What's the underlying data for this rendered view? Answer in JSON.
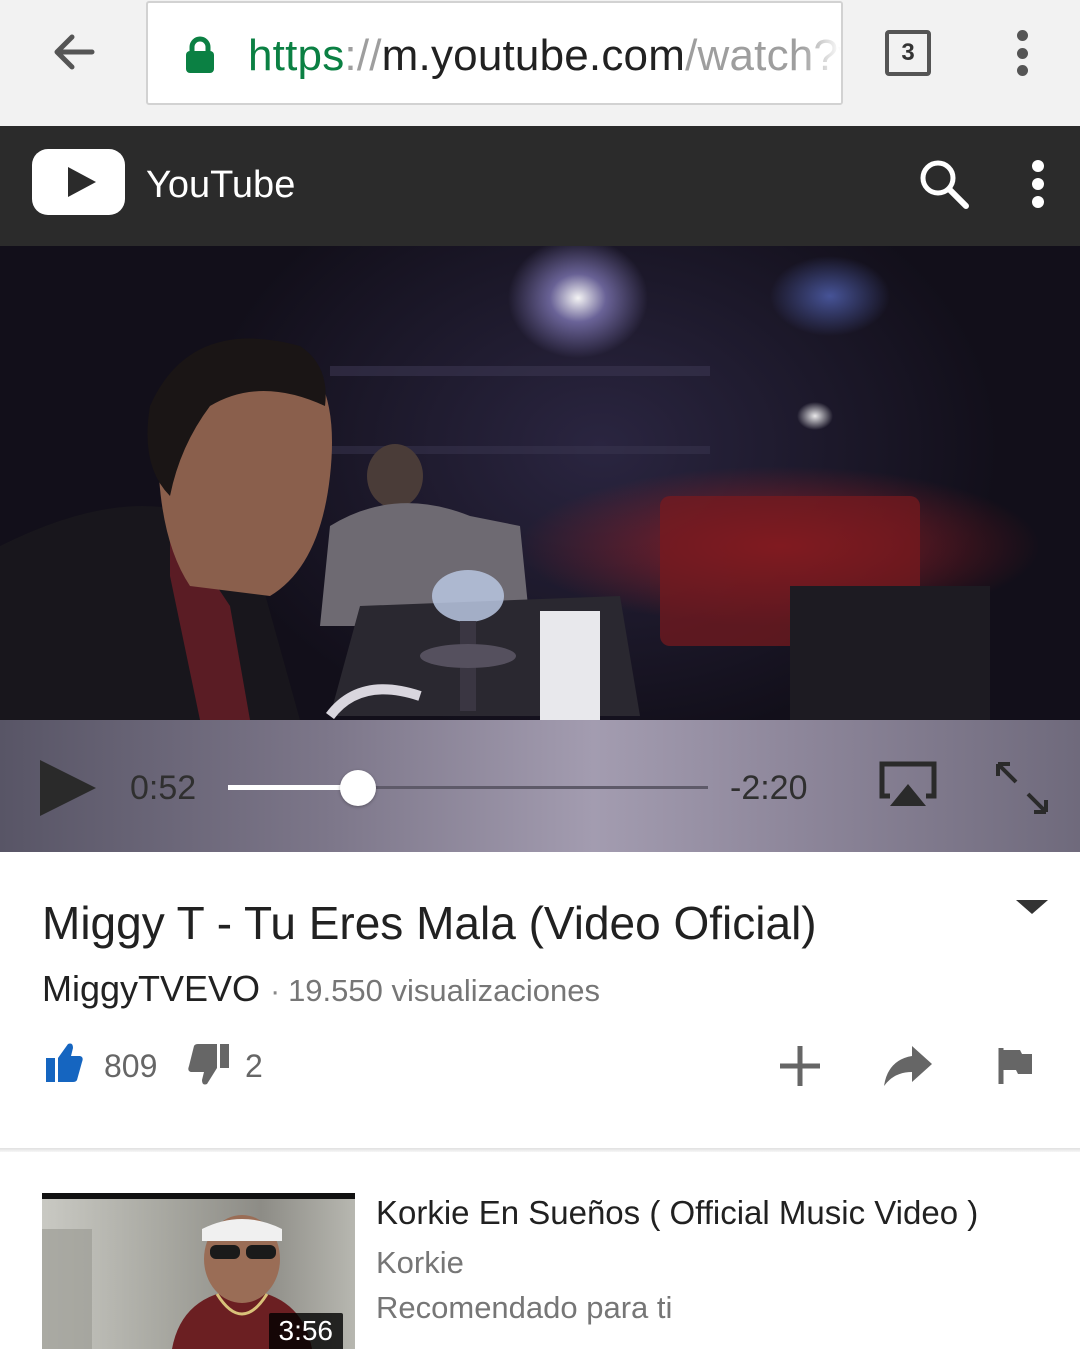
{
  "browser": {
    "url_scheme": "https",
    "url_separator": "://",
    "url_host": "m.youtube.com",
    "url_path": "/watch?v",
    "tab_count": "3",
    "icons": {
      "back": "back-arrow-icon",
      "lock": "lock-icon",
      "menu": "vertical-dots-icon"
    },
    "scheme_color": "#0b8043"
  },
  "header": {
    "title": "YouTube",
    "icons": {
      "logo": "youtube-logo-icon",
      "search": "search-icon",
      "menu": "vertical-dots-icon"
    }
  },
  "player": {
    "state": "paused",
    "elapsed": "0:52",
    "remaining": "-2:20",
    "progress_fraction": 0.27,
    "icons": {
      "play": "play-icon",
      "airplay": "airplay-icon",
      "fullscreen": "fullscreen-icon"
    }
  },
  "video": {
    "title": "Miggy T - Tu Eres Mala (Video Oficial)",
    "channel": "MiggyTVEVO",
    "separator": "·",
    "views": "19.550 visualizaciones",
    "likes": "809",
    "dislikes": "2",
    "like_color": "#1565c0",
    "actions": [
      "add-to-playlist-icon",
      "share-icon",
      "flag-icon"
    ]
  },
  "recommended": [
    {
      "title": "Korkie En Sueños ( Official Music Video )",
      "channel": "Korkie",
      "reason": "Recomendado para ti",
      "duration": "3:56"
    }
  ]
}
